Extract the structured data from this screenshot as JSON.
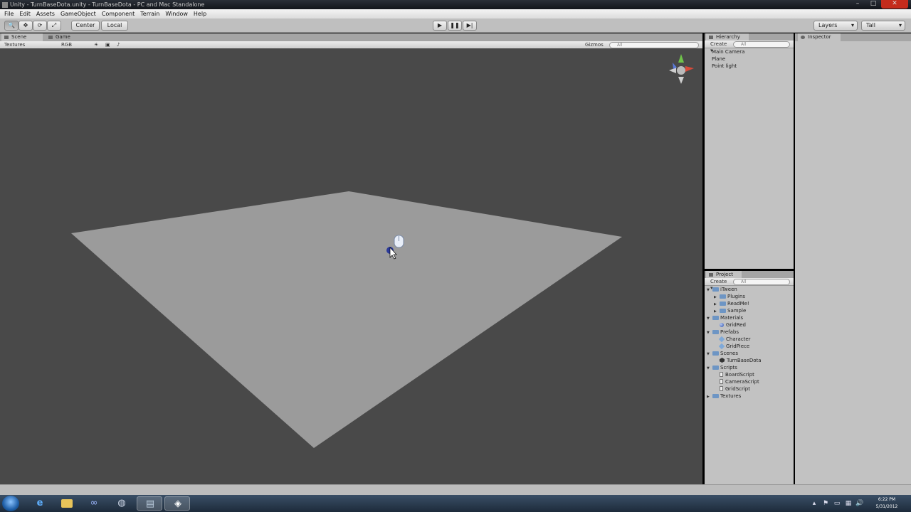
{
  "window": {
    "title": "Unity - TurnBaseDota.unity - TurnBaseDota - PC and Mac Standalone"
  },
  "menu": {
    "items": [
      "File",
      "Edit",
      "Assets",
      "GameObject",
      "Component",
      "Terrain",
      "Window",
      "Help"
    ]
  },
  "toolbar": {
    "pivot_label": "Center",
    "space_label": "Local",
    "layers_label": "Layers",
    "layout_label": "Tall"
  },
  "scene_view": {
    "tabs": [
      "Scene",
      "Game"
    ],
    "draw_mode": "Textures",
    "render_mode": "RGB",
    "gizmos_label": "Gizmos",
    "search_placeholder": "All"
  },
  "hierarchy": {
    "tab_label": "Hierarchy",
    "create_label": "Create",
    "search_placeholder": "All",
    "items": [
      "Main Camera",
      "Plane",
      "Point light"
    ]
  },
  "inspector": {
    "tab_label": "Inspector"
  },
  "project": {
    "tab_label": "Project",
    "create_label": "Create",
    "search_placeholder": "All",
    "tree": [
      {
        "label": "iTween",
        "kind": "folder",
        "depth": 0,
        "expanded": true
      },
      {
        "label": "Plugins",
        "kind": "folder",
        "depth": 1,
        "expanded": false
      },
      {
        "label": "ReadMe!",
        "kind": "folder",
        "depth": 1,
        "expanded": false
      },
      {
        "label": "Sample",
        "kind": "folder",
        "depth": 1,
        "expanded": false
      },
      {
        "label": "Materials",
        "kind": "folder",
        "depth": 0,
        "expanded": true
      },
      {
        "label": "GridRed",
        "kind": "material",
        "depth": 1
      },
      {
        "label": "Prefabs",
        "kind": "folder",
        "depth": 0,
        "expanded": true
      },
      {
        "label": "Character",
        "kind": "prefab",
        "depth": 1
      },
      {
        "label": "GridPiece",
        "kind": "prefab",
        "depth": 1
      },
      {
        "label": "Scenes",
        "kind": "folder",
        "depth": 0,
        "expanded": true
      },
      {
        "label": "TurnBaseDota",
        "kind": "scene",
        "depth": 1
      },
      {
        "label": "Scripts",
        "kind": "folder",
        "depth": 0,
        "expanded": true
      },
      {
        "label": "BoardScript",
        "kind": "script",
        "depth": 1
      },
      {
        "label": "CameraScript",
        "kind": "script",
        "depth": 1
      },
      {
        "label": "GridScript",
        "kind": "script",
        "depth": 1
      },
      {
        "label": "Textures",
        "kind": "folder",
        "depth": 0,
        "expanded": false
      }
    ]
  },
  "taskbar": {
    "time": "6:22 PM",
    "date": "5/31/2012"
  },
  "colors": {
    "scene_background": "#494949",
    "plane": "#9a9a9a",
    "panel": "#c2c2c2",
    "taskbar": "#1d2b3b"
  }
}
